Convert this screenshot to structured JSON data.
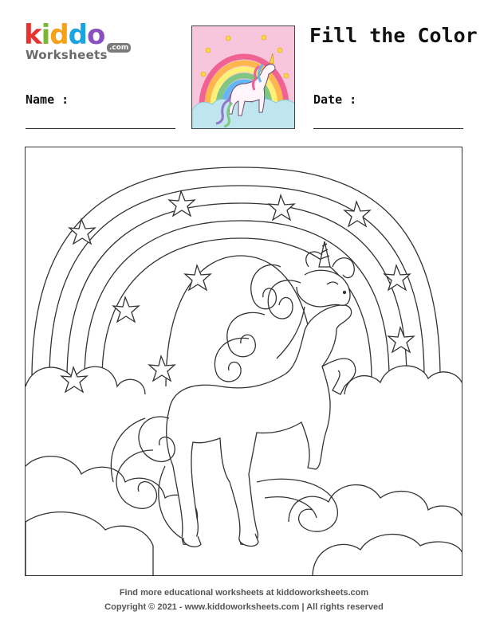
{
  "logo": {
    "letters": [
      {
        "ch": "k",
        "color": "#e8322f"
      },
      {
        "ch": "i",
        "color": "#7cb733"
      },
      {
        "ch": "d",
        "color": "#f6a11a"
      },
      {
        "ch": "d",
        "color": "#1aa4e0"
      },
      {
        "ch": "o",
        "color": "#8a4fc2"
      }
    ],
    "subtitle": "Worksheets",
    "domain": ".com"
  },
  "header": {
    "title": "Fill the Color",
    "name_label": "Name :",
    "date_label": "Date :"
  },
  "footer": {
    "line1": "Find more educational worksheets at kiddoworksheets.com",
    "line2": "Copyright © 2021 - www.kiddoworksheets.com  |  All rights reserved"
  },
  "colors": {
    "thumb_sky": "#f7c6dc",
    "thumb_cloud": "#bfe6ee",
    "rainbow": [
      "#f06292",
      "#ffb74d",
      "#fff176",
      "#81c784",
      "#64b5f6",
      "#9575cd"
    ],
    "outline": "#333333"
  }
}
